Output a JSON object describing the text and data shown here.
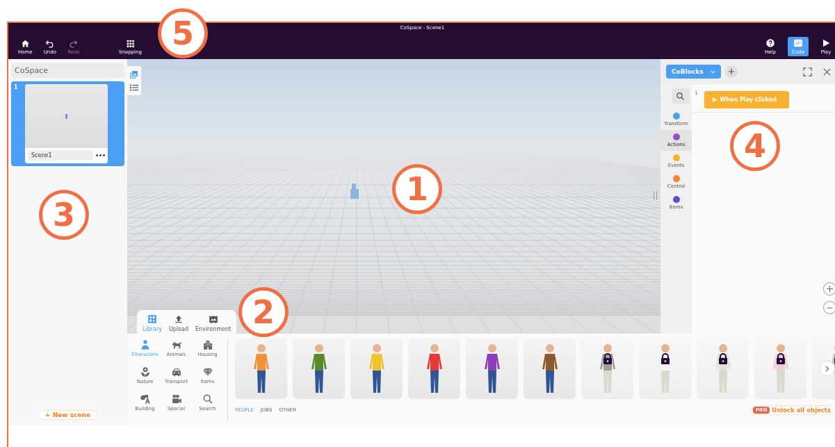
{
  "window": {
    "title": "CoSpace - Scene1"
  },
  "toolbar": {
    "left": [
      {
        "kind": "home",
        "label": "Home",
        "disabled": false
      },
      {
        "kind": "undo",
        "label": "Undo",
        "disabled": false
      },
      {
        "kind": "redo",
        "label": "Redo",
        "disabled": true
      },
      {
        "kind": "grid",
        "label": "Snapping",
        "disabled": false
      }
    ],
    "right": [
      {
        "kind": "help",
        "label": "Help",
        "selected": false
      },
      {
        "kind": "code",
        "label": "Code",
        "selected": true
      },
      {
        "kind": "play",
        "label": "Play",
        "selected": false
      }
    ]
  },
  "scenes_panel": {
    "title": "CoSpace",
    "scenes": [
      {
        "number": "1",
        "name": "Scene1",
        "selected": true
      }
    ],
    "new_scene": "+ New scene"
  },
  "library": {
    "tabs": [
      {
        "kind": "library",
        "label": "Library",
        "selected": true
      },
      {
        "kind": "upload",
        "label": "Upload",
        "selected": false
      },
      {
        "kind": "environment",
        "label": "Environment",
        "selected": false
      }
    ],
    "categories": [
      {
        "kind": "person",
        "label": "Characters",
        "selected": true
      },
      {
        "kind": "dog",
        "label": "Animals",
        "selected": false
      },
      {
        "kind": "building",
        "label": "Housing",
        "selected": false
      },
      {
        "kind": "flower",
        "label": "Nature",
        "selected": false
      },
      {
        "kind": "car",
        "label": "Transport",
        "selected": false
      },
      {
        "kind": "gem",
        "label": "Items",
        "selected": false
      },
      {
        "kind": "shapes",
        "label": "Building",
        "selected": false
      },
      {
        "kind": "camera",
        "label": "Special",
        "selected": false
      },
      {
        "kind": "search",
        "label": "Search",
        "selected": false
      }
    ],
    "items": [
      {
        "locked": false,
        "color": "#f0903a"
      },
      {
        "locked": false,
        "color": "#5a8a2a"
      },
      {
        "locked": false,
        "color": "#f2c12e"
      },
      {
        "locked": false,
        "color": "#e53935"
      },
      {
        "locked": false,
        "color": "#8a3fb8"
      },
      {
        "locked": false,
        "color": "#8a5a2b"
      },
      {
        "locked": true,
        "color": "#9e9e9e"
      },
      {
        "locked": true,
        "color": "#f4f4f4"
      },
      {
        "locked": true,
        "color": "#e0e0e0"
      },
      {
        "locked": true,
        "color": "#f2c8d8"
      },
      {
        "locked": true,
        "color": "#bdbdbd"
      }
    ],
    "filters": [
      {
        "label": "PEOPLE",
        "selected": true
      },
      {
        "label": "JOBS",
        "selected": false
      },
      {
        "label": "OTHER",
        "selected": false
      }
    ],
    "pro_badge": "PRO",
    "unlock": "Unlock all objects"
  },
  "code_panel": {
    "language": "CoBlocks",
    "categories": [
      {
        "label": "Transform",
        "color": "#4aa3df",
        "selected": false
      },
      {
        "label": "Actions",
        "color": "#9b4fc4",
        "selected": true
      },
      {
        "label": "Events",
        "color": "#f7b22b",
        "selected": false
      },
      {
        "label": "Control",
        "color": "#f5843a",
        "selected": false
      },
      {
        "label": "Items",
        "color": "#5b4fd4",
        "selected": false
      }
    ],
    "line_number": "1",
    "block": "When Play clicked"
  },
  "annotations": [
    {
      "label": "5"
    },
    {
      "label": "3"
    },
    {
      "label": "1"
    },
    {
      "label": "2"
    },
    {
      "label": "4"
    }
  ]
}
